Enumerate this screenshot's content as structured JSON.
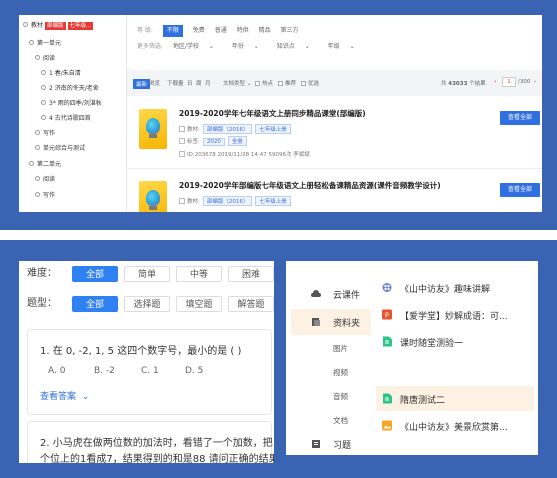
{
  "colors": {
    "frame": "#3a63b3",
    "primary": "#2f6fe0",
    "red": "#e53935",
    "highlight": "#fdf1e4"
  },
  "top": {
    "sidebar": {
      "root_label": "教材",
      "chips": [
        "部编版",
        "七年级..."
      ],
      "tree": [
        "第一单元",
        "阅读",
        "1 春/朱自清",
        "2 济南的冬天/老舍",
        "3* 雨的四季/刘湛秋",
        "4 古代诗歌四首",
        "写作",
        "单元综合与测试",
        "第二单元",
        "阅读",
        "写作"
      ]
    },
    "filters": {
      "row1": {
        "label": "等    级:",
        "selected": "不限",
        "options": [
          "免费",
          "普通",
          "特供",
          "精品",
          "第三方"
        ]
      },
      "row2": {
        "label": "更多筛选:",
        "options": [
          "地区/学校",
          "年份",
          "知识点",
          "年级"
        ]
      }
    },
    "toolbar": {
      "tabs": [
        "最新",
        "浏览",
        "下载量",
        "日",
        "周",
        "月"
      ],
      "format": "文档类型",
      "checks": [
        "热点",
        "推荐",
        "优选"
      ],
      "total_prefix": "共",
      "total": "43033",
      "total_suffix": "个结果",
      "page_current": "1",
      "page_total": "/300"
    },
    "resources": [
      {
        "title": "2019-2020学年七年级语文上册同步精品课堂(部编版)",
        "meta1_label": "教材:",
        "meta1_tags": [
          "部编版（2016）",
          "七年级上册"
        ],
        "meta2_label": "标签:",
        "meta2_tags": [
          "2020",
          "全册"
        ],
        "meta3": "ID:203678  2019/11/28 14:47  59096次  李斌斌",
        "button": "查看全部"
      },
      {
        "title": "2019-2020学年部编版七年级语文上册轻松备课精品资源(课件音频教学设计)",
        "meta1_label": "教材:",
        "meta1_tags": [
          "部编版（2016）",
          "七年级上册"
        ],
        "button": "查看全部"
      }
    ]
  },
  "quiz": {
    "difficulty_label": "难度：",
    "difficulty": [
      "全部",
      "简单",
      "中等",
      "困难"
    ],
    "type_label": "题型：",
    "types": [
      "全部",
      "选择题",
      "填空题",
      "解答题"
    ],
    "q1": "1. 在 0, -2, 1, 5 这四个数字号，最小的是 (      )",
    "q1_options": [
      "A. 0",
      "B. -2",
      "C. 1",
      "D. 5"
    ],
    "view_answer": "查看答案",
    "q2_line1": "2.  小马虎在做两位数的加法时，看错了一个加数，把",
    "q2_line2": "个位上的1看成7，结果得到的和是88 请问正确的结果"
  },
  "library": {
    "nav": [
      {
        "label": "云课件",
        "icon": "cloud-icon"
      },
      {
        "label": "资料夹",
        "icon": "folder-icon"
      }
    ],
    "sub": [
      "图片",
      "视频",
      "音频",
      "文档"
    ],
    "nav_bottom": {
      "label": "习题",
      "icon": "exercise-icon"
    },
    "items": [
      {
        "label": "《山中访友》趣味讲解",
        "icon": "video-icon"
      },
      {
        "label": "【爱学堂】妙解成语：可...",
        "icon": "ppt-icon"
      },
      {
        "label": "课时随堂测验一",
        "icon": "doc-icon"
      },
      {
        "label": "隋唐测试二",
        "icon": "doc-icon"
      },
      {
        "label": "《山中访友》美景欣赏第...",
        "icon": "image-icon"
      }
    ]
  }
}
